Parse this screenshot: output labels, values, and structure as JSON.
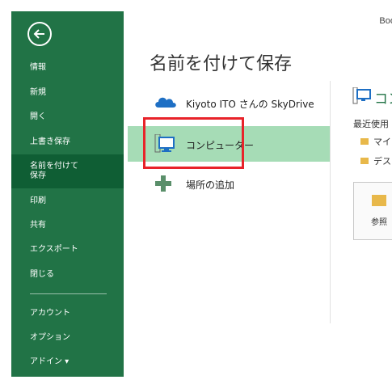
{
  "window": {
    "title": "Boo"
  },
  "sidebar": {
    "items": [
      {
        "label": "情報",
        "selected": false
      },
      {
        "label": "新規",
        "selected": false
      },
      {
        "label": "開く",
        "selected": false
      },
      {
        "label": "上書き保存",
        "selected": false
      },
      {
        "label_line1": "名前を付けて",
        "label_line2": "保存",
        "selected": true
      },
      {
        "label": "印刷",
        "selected": false
      },
      {
        "label": "共有",
        "selected": false
      },
      {
        "label": "エクスポート",
        "selected": false
      },
      {
        "label": "閉じる",
        "selected": false
      },
      {
        "label": "アカウント",
        "selected": false
      },
      {
        "label": "オプション",
        "selected": false
      },
      {
        "label": "アドイン ▾",
        "selected": false
      }
    ]
  },
  "main": {
    "title": "名前を付けて保存",
    "places": [
      {
        "label": "Kiyoto ITO さんの SkyDrive",
        "icon": "cloud-icon",
        "selected": false
      },
      {
        "label": "コンピューター",
        "icon": "computer-icon",
        "selected": true
      },
      {
        "label": "場所の追加",
        "icon": "plus-icon",
        "selected": false
      }
    ]
  },
  "right_panel": {
    "title": "コン",
    "recent_label": "最近使用",
    "recent_folders": [
      {
        "label": "マイ"
      },
      {
        "label": "デスク"
      }
    ],
    "browse_label": "参照"
  },
  "colors": {
    "sidebar_bg": "#217346",
    "sidebar_selected": "#0f5e34",
    "place_selected": "#a6dcb6",
    "highlight": "#e8232a",
    "accent": "#217346"
  }
}
